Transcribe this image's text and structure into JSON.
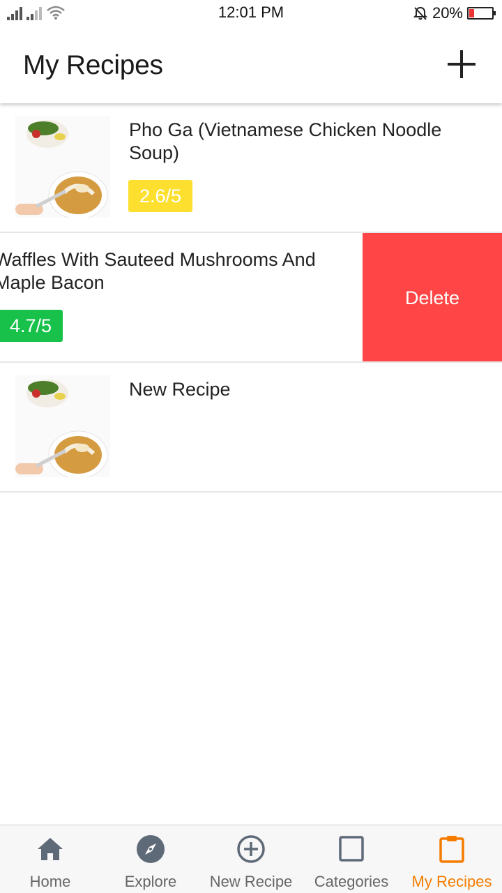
{
  "status_bar": {
    "time": "12:01 PM",
    "battery": "20%",
    "battery_fraction": 0.2
  },
  "header": {
    "title": "My Recipes"
  },
  "recipes": [
    {
      "title": "Pho Ga (Vietnamese Chicken Noodle Soup)",
      "rating": "2.6/5",
      "rating_color": "#fde02f"
    },
    {
      "title": "Waffles With Sauteed Mushrooms And Maple Bacon",
      "rating": "4.7/5",
      "rating_color": "#18c24a",
      "delete_label": "Delete"
    },
    {
      "title": "New Recipe"
    }
  ],
  "bottom_nav": {
    "items": [
      {
        "label": "Home",
        "icon": "home-icon"
      },
      {
        "label": "Explore",
        "icon": "compass-icon"
      },
      {
        "label": "New Recipe",
        "icon": "plus-circle-icon"
      },
      {
        "label": "Categories",
        "icon": "square-icon"
      },
      {
        "label": "My Recipes",
        "icon": "clipboard-icon",
        "active": true
      }
    ],
    "active_color": "#f57c00"
  }
}
